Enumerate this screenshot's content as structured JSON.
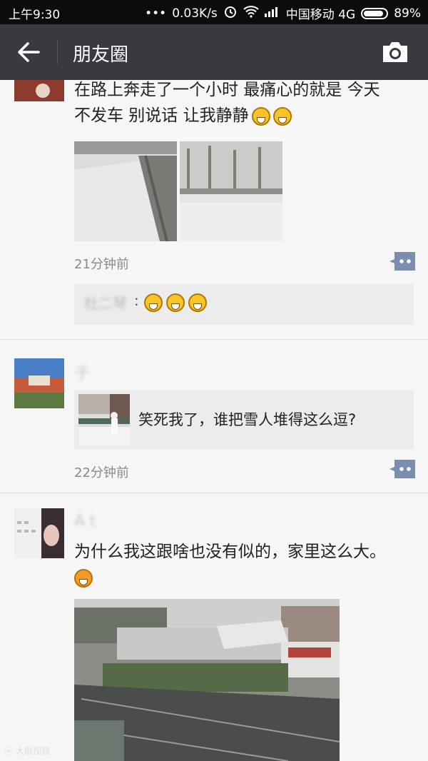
{
  "status_bar": {
    "time": "上午9:30",
    "net_speed": "0.03K/s",
    "carrier": "中国移动 4G",
    "battery": "89%",
    "battery_level": 0.89
  },
  "nav": {
    "title": "朋友圈"
  },
  "posts": [
    {
      "text_line1": "在路上奔走了一个小时 最痛心的就是 今天",
      "text_line2": "不发车 别说话 让我静静",
      "time": "21分钟前",
      "comment_name": "杜二琴",
      "comment_sep": ":"
    },
    {
      "author": "于",
      "share_text": "笑死我了，谁把雪人堆得这么逗?",
      "time": "22分钟前"
    },
    {
      "author": "A t",
      "text_line1": "为什么我这跟啥也没有似的，家里这么大。"
    }
  ],
  "watermark": "大眼视频",
  "icons": {
    "back": "back-arrow-icon",
    "camera": "camera-icon",
    "comment": "comment-more-icon",
    "wifi": "wifi-icon",
    "signal": "signal-icon",
    "alarm": "alarm-icon"
  }
}
